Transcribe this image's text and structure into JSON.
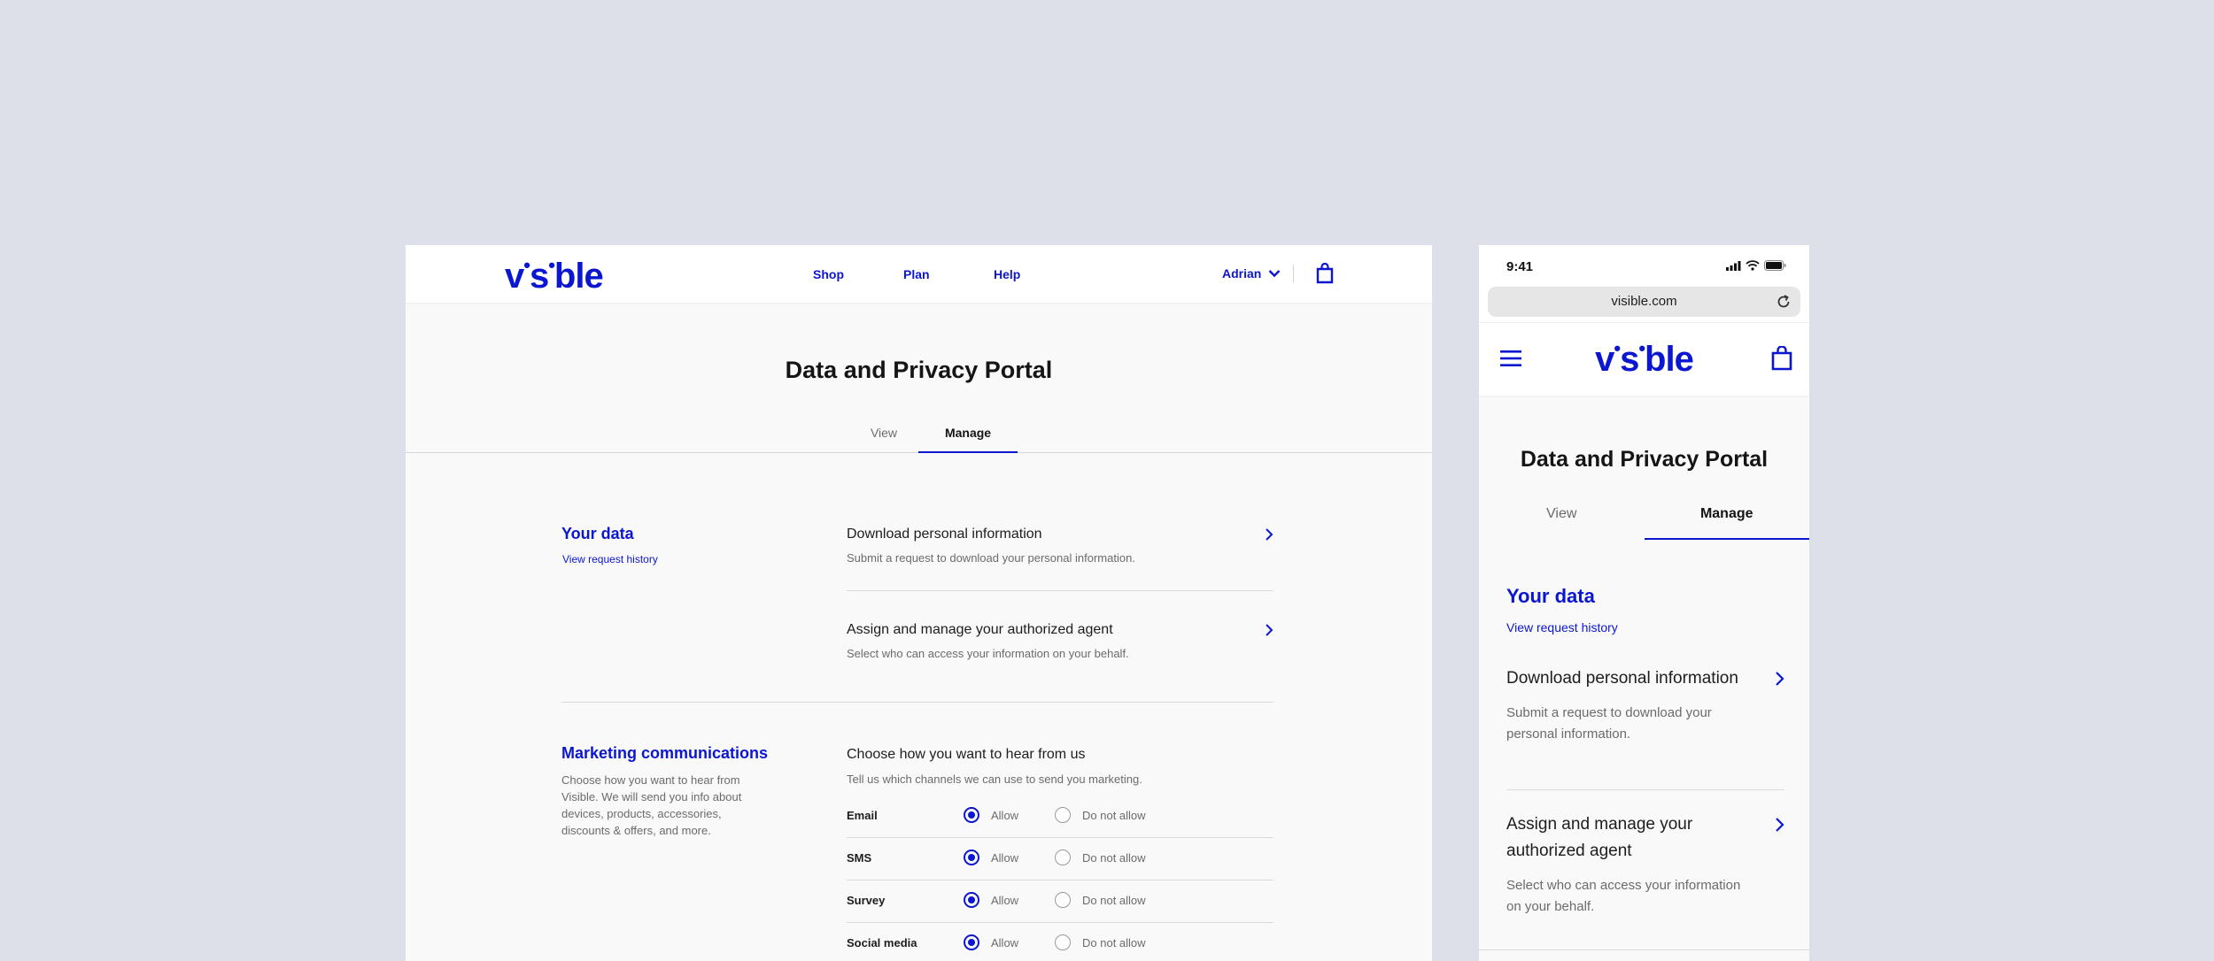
{
  "brand": {
    "logo": "v·s·ble",
    "color": "#0b16d0"
  },
  "desktop": {
    "nav": {
      "links": [
        "Shop",
        "Plan",
        "Help"
      ],
      "user": "Adrian"
    },
    "title": "Data and Privacy Portal",
    "tabs": {
      "view": "View",
      "manage": "Manage",
      "active": "Manage"
    },
    "your_data": {
      "title": "Your data",
      "link": "View request history",
      "items": [
        {
          "title": "Download personal information",
          "sub": "Submit a request to download your personal information."
        },
        {
          "title": "Assign and manage your authorized agent",
          "sub": "Select who can access your information on your behalf."
        }
      ]
    },
    "marketing": {
      "title": "Marketing communications",
      "desc": "Choose how you want to hear from Visible. We will send you info about devices, products, accessories, discounts & offers, and more.",
      "choose_title": "Choose how you want to hear from us",
      "choose_sub": "Tell us which channels we can use to send you marketing.",
      "allow_label": "Allow",
      "deny_label": "Do not allow",
      "channels": [
        {
          "name": "Email",
          "value": "Allow"
        },
        {
          "name": "SMS",
          "value": "Allow"
        },
        {
          "name": "Survey",
          "value": "Allow"
        },
        {
          "name": "Social media",
          "value": "Allow"
        }
      ]
    }
  },
  "mobile": {
    "status": {
      "time": "9:41"
    },
    "url": "visible.com",
    "title": "Data and Privacy Portal",
    "tabs": {
      "view": "View",
      "manage": "Manage",
      "active": "Manage"
    },
    "your_data": {
      "title": "Your data",
      "link": "View request history",
      "items": [
        {
          "title": "Download personal information",
          "sub": "Submit a request to download your personal information."
        },
        {
          "title": "Assign and manage your authorized agent",
          "sub": "Select who can access your information on your behalf."
        }
      ]
    }
  }
}
